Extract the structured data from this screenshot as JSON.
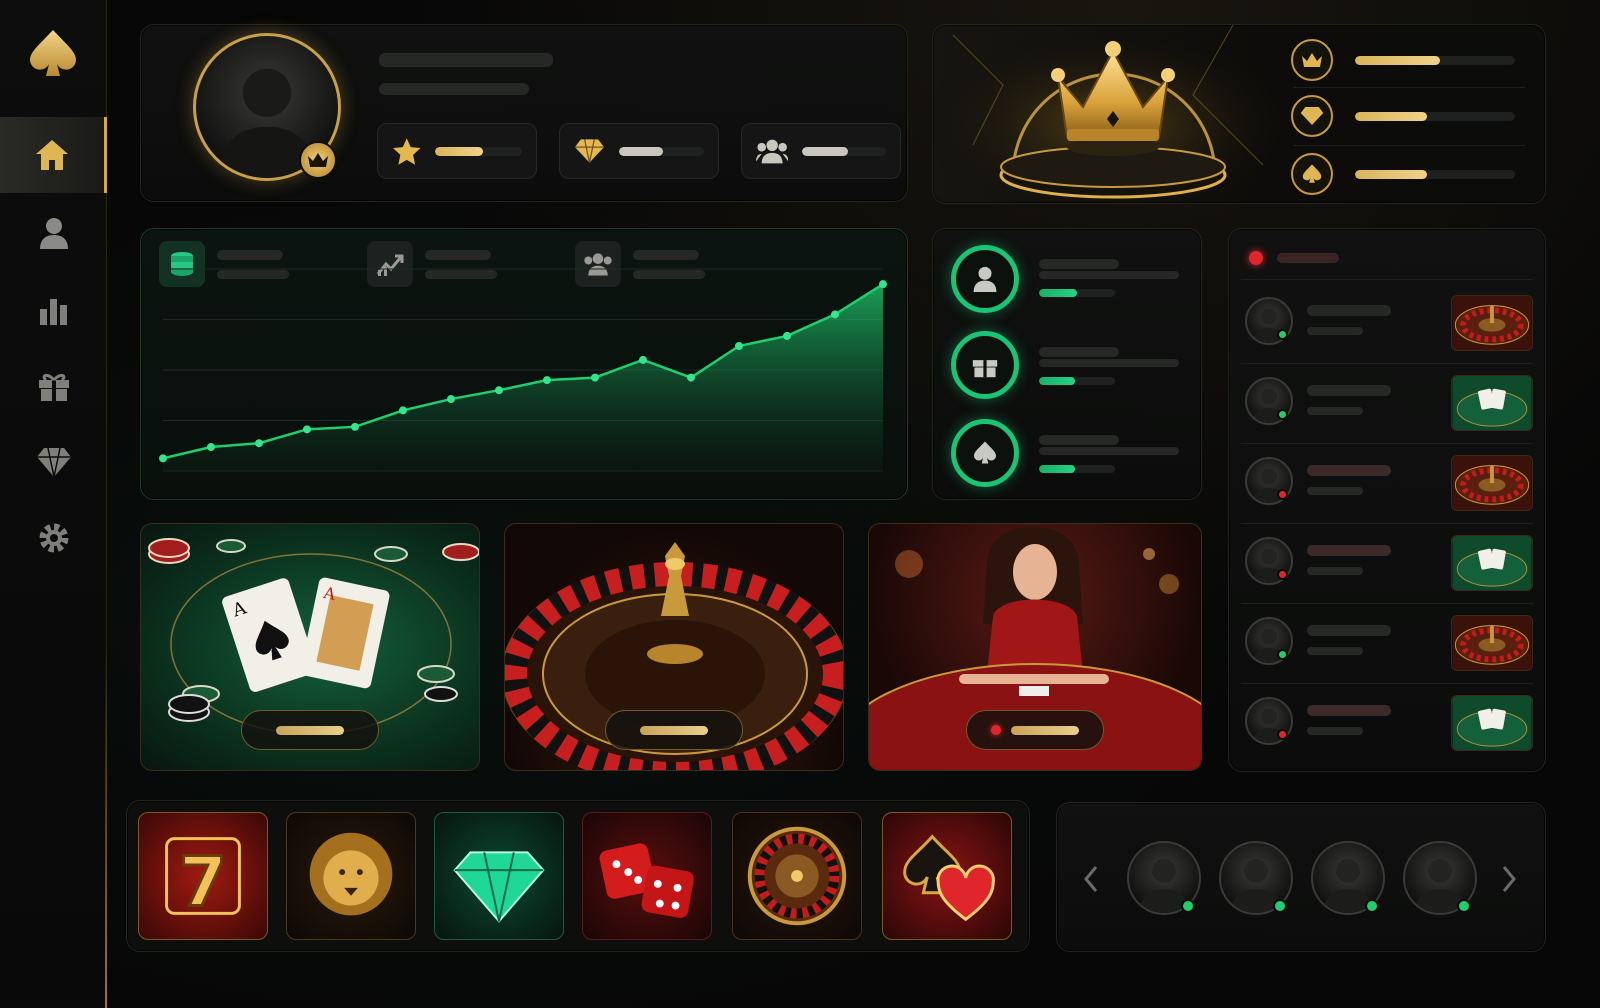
{
  "colors": {
    "gold": "#d9b45a",
    "green": "#1fcf6e",
    "red": "#e0262d",
    "background": "#070707"
  },
  "sidebar": {
    "logo_icon": "spade-icon",
    "items": [
      {
        "icon": "home-icon",
        "active": true
      },
      {
        "icon": "user-icon",
        "active": false
      },
      {
        "icon": "bar-chart-icon",
        "active": false
      },
      {
        "icon": "gift-icon",
        "active": false
      },
      {
        "icon": "diamond-icon",
        "active": false
      },
      {
        "icon": "gear-icon",
        "active": false
      }
    ]
  },
  "profile": {
    "avatar_icon": "user-silhouette-icon",
    "badge_icon": "crown-icon",
    "stats": [
      {
        "icon": "star-icon",
        "progress": 0.55
      },
      {
        "icon": "diamond-icon",
        "progress": 0.52
      },
      {
        "icon": "users-icon",
        "progress": 0.55
      }
    ]
  },
  "vip": {
    "crown_icon": "crown-icon",
    "tiers": [
      {
        "icon": "crown-icon",
        "progress": 0.53
      },
      {
        "icon": "diamond-icon",
        "progress": 0.45
      },
      {
        "icon": "spade-icon",
        "progress": 0.45
      }
    ]
  },
  "chart_data": {
    "type": "area",
    "title": "",
    "xlabel": "",
    "ylabel": "",
    "legend_icons": [
      "coins-icon",
      "trend-up-icon",
      "users-icon"
    ],
    "x": [
      1,
      2,
      3,
      4,
      5,
      6,
      7,
      8,
      9,
      10,
      11,
      12,
      13,
      14,
      15,
      16
    ],
    "values": [
      10,
      19,
      22,
      33,
      35,
      48,
      57,
      64,
      72,
      74,
      88,
      74,
      99,
      107,
      124,
      148
    ],
    "ylim": [
      0,
      160
    ],
    "grid": true,
    "color": "#1fcf6e"
  },
  "achievements": [
    {
      "icon": "user-icon",
      "progress": 0.5
    },
    {
      "icon": "gift-icon",
      "progress": 0.48
    },
    {
      "icon": "spade-icon",
      "progress": 0.48
    }
  ],
  "live_players": {
    "status_icon": "live-indicator-icon",
    "rows": [
      {
        "status": "online",
        "game_icon": "roulette-icon"
      },
      {
        "status": "online",
        "game_icon": "blackjack-icon"
      },
      {
        "status": "busy",
        "game_icon": "roulette-icon"
      },
      {
        "status": "busy",
        "game_icon": "blackjack-icon"
      },
      {
        "status": "online",
        "game_icon": "roulette-icon"
      },
      {
        "status": "busy",
        "game_icon": "blackjack-icon"
      }
    ]
  },
  "game_cards": [
    {
      "name_icon": "blackjack-table-icon"
    },
    {
      "name_icon": "roulette-wheel-icon"
    },
    {
      "name_icon": "live-dealer-icon",
      "live": true
    }
  ],
  "slot_tiles": [
    "lucky-seven-icon",
    "lion-icon",
    "emerald-icon",
    "dice-icon",
    "roulette-icon",
    "card-suits-icon"
  ],
  "friends": {
    "prev_icon": "chevron-left-icon",
    "next_icon": "chevron-right-icon",
    "count": 4
  }
}
